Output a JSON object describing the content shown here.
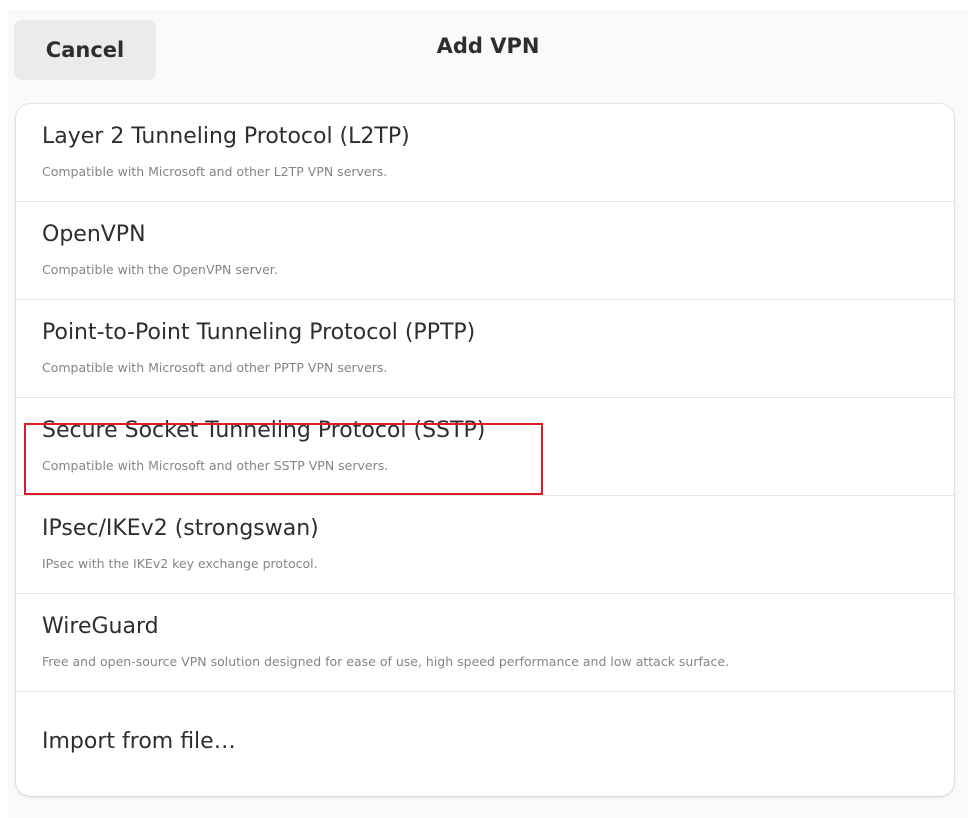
{
  "header": {
    "cancel_label": "Cancel",
    "title": "Add VPN"
  },
  "vpn_options": [
    {
      "title": "Layer 2 Tunneling Protocol (L2TP)",
      "subtitle": "Compatible with Microsoft and other L2TP VPN servers."
    },
    {
      "title": "OpenVPN",
      "subtitle": "Compatible with the OpenVPN server."
    },
    {
      "title": "Point-to-Point Tunneling Protocol (PPTP)",
      "subtitle": "Compatible with Microsoft and other PPTP VPN servers."
    },
    {
      "title": "Secure Socket Tunneling Protocol (SSTP)",
      "subtitle": "Compatible with Microsoft and other SSTP VPN servers."
    },
    {
      "title": "IPsec/IKEv2 (strongswan)",
      "subtitle": "IPsec with the IKEv2 key exchange protocol."
    },
    {
      "title": "WireGuard",
      "subtitle": "Free and open-source VPN solution designed for ease of use, high speed performance and low attack surface."
    }
  ],
  "import_label": "Import from file…",
  "colors": {
    "highlight": "#e01b24",
    "button_bg": "#ebebeb",
    "subtitle": "#858585"
  }
}
